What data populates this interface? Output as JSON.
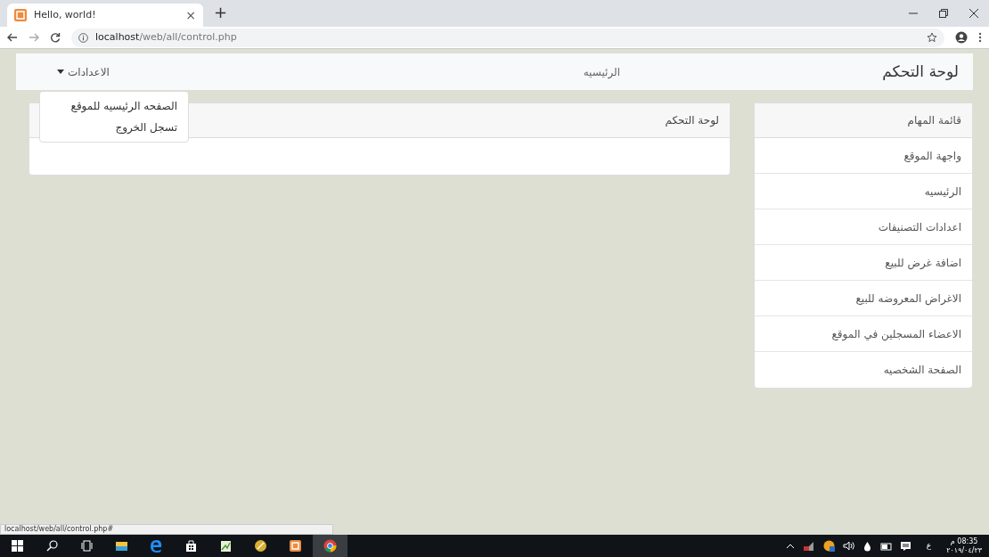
{
  "browser": {
    "tab_title": "Hello, world!",
    "tab_close": "×",
    "new_tab": "+",
    "url_host": "localhost",
    "url_path": "/web/all/control.php"
  },
  "navbar": {
    "brand": "لوحة التحكم",
    "links": [
      {
        "label": "الرئيسيه",
        "kind": "link"
      },
      {
        "label": "الاعدادات",
        "kind": "dropdown",
        "expanded": true
      }
    ],
    "dropdown_items": [
      "الصفحه الرئيسيه للموقع",
      "تسجل الخروج"
    ]
  },
  "sidebar": {
    "items": [
      {
        "label": "قائمة المهام",
        "kind": "header"
      },
      {
        "label": "واجهة الموقع",
        "kind": "link"
      },
      {
        "label": "الرئيسيه",
        "kind": "link"
      },
      {
        "label": "اعدادات التصنيفات",
        "kind": "link"
      },
      {
        "label": "اضافة غرض للبيع",
        "kind": "link"
      },
      {
        "label": "الاغراض المعروضه للبيع",
        "kind": "link"
      },
      {
        "label": "الاعضاء المسجلين في الموقع",
        "kind": "link"
      },
      {
        "label": "الصفحة الشخصيه",
        "kind": "link"
      }
    ]
  },
  "main_card": {
    "header": "لوحة التحكم"
  },
  "status_url": "localhost/web/all/control.php#",
  "taskbar": {
    "keyboard": "ع",
    "time": "08:35 م",
    "date": "٢٠١٩/٠٤/٢٣"
  }
}
